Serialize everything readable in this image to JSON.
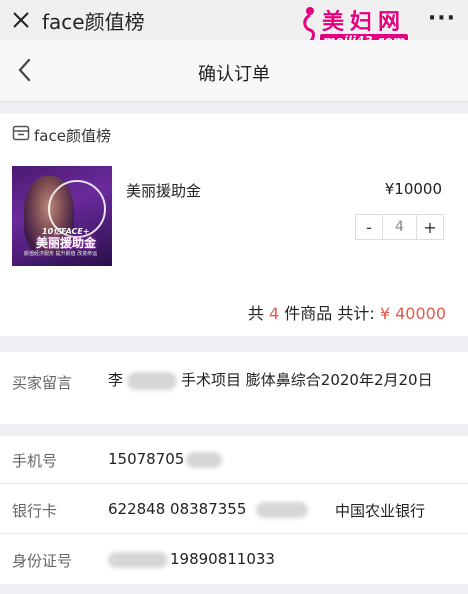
{
  "app_bar": {
    "close_icon": "close-icon",
    "title": "face颜值榜",
    "more_label": "···"
  },
  "watermark": {
    "text": "美妇网",
    "url": "meili43.com"
  },
  "page_header": {
    "back_icon": "chevron-left-icon",
    "title": "确认订单"
  },
  "order": {
    "shop_icon": "shop-icon",
    "shop_name": "face颜值榜",
    "product": {
      "image_text_line1": "10亿FACE+",
      "image_text_line2": "美丽援助金",
      "image_text_line3": "颜值经济服务 提升颜值 改变命运",
      "name": "美丽援助金",
      "price": "¥10000",
      "quantity": "4",
      "minus_label": "-",
      "plus_label": "+"
    },
    "summary": {
      "prefix": "共",
      "count": "4",
      "middle": "件商品 共计:",
      "total": "¥ 40000"
    }
  },
  "buyer_message": {
    "label": "买家留言",
    "text_start": "李",
    "text_rest": "手术项目 膨体鼻综合2020年2月20日"
  },
  "info": {
    "phone": {
      "label": "手机号",
      "value": "15078705"
    },
    "bank_card": {
      "label": "银行卡",
      "value": "622848 08387355",
      "bank_name": "中国农业银行"
    },
    "id_number": {
      "label": "身份证号",
      "value": "19890811033"
    }
  },
  "colors": {
    "accent_red": "#e65a4c",
    "watermark_pink": "#e4007f"
  }
}
